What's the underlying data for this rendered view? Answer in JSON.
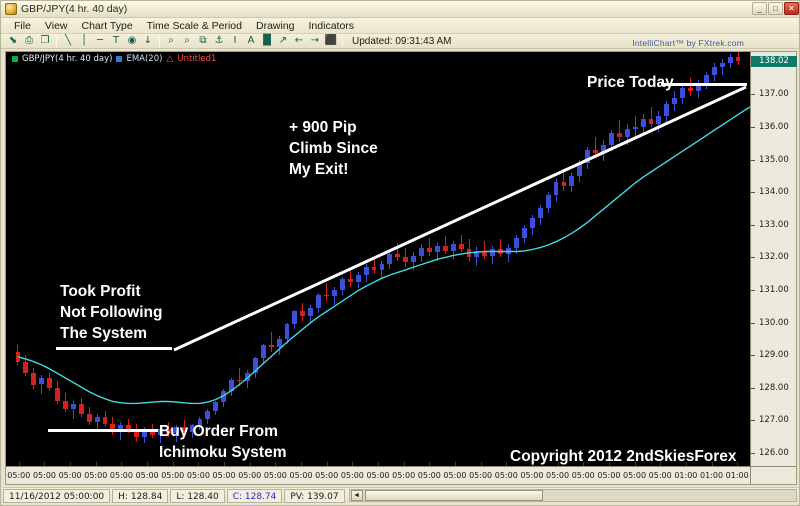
{
  "window": {
    "title": "GBP/JPY(4 hr.  40 day)",
    "app_icon": "chart-window-icon",
    "buttons": [
      {
        "name": "minimize",
        "glyph": "_"
      },
      {
        "name": "maximize",
        "glyph": "□"
      },
      {
        "name": "close",
        "glyph": "✕"
      }
    ]
  },
  "menubar": {
    "items": [
      {
        "label": "File"
      },
      {
        "label": "View"
      },
      {
        "label": "Chart Type"
      },
      {
        "label": "Time Scale & Period"
      },
      {
        "label": "Drawing"
      },
      {
        "label": "Indicators"
      }
    ]
  },
  "toolbar": {
    "updated_label": "Updated: 09:31:43 AM",
    "tools": [
      {
        "name": "cursor-select-icon",
        "glyph": "⬊"
      },
      {
        "name": "print-icon",
        "glyph": "⎙"
      },
      {
        "name": "copy-icon",
        "glyph": "❐"
      },
      {
        "name": "trendline-icon",
        "glyph": "╲"
      },
      {
        "name": "vertical-line-icon",
        "glyph": "│"
      },
      {
        "name": "horizontal-line-icon",
        "glyph": "─"
      },
      {
        "name": "text-tool-icon",
        "glyph": "T"
      },
      {
        "name": "ellipse-icon",
        "glyph": "◉"
      },
      {
        "name": "arrow-down-icon",
        "glyph": "↓"
      },
      {
        "name": "zoom-in-icon",
        "glyph": "⌕"
      },
      {
        "name": "zoom-out-icon",
        "glyph": "⌕"
      },
      {
        "name": "fib-retracement-icon",
        "glyph": "⧉"
      },
      {
        "name": "anchor-icon",
        "glyph": "⚓"
      },
      {
        "name": "i-beam-icon",
        "glyph": "I"
      },
      {
        "name": "font-icon",
        "glyph": "A"
      },
      {
        "name": "bar-chart-icon",
        "glyph": "█"
      },
      {
        "name": "line-chart-icon",
        "glyph": "↗"
      },
      {
        "name": "scroll-left-icon",
        "glyph": "←"
      },
      {
        "name": "scroll-right-icon",
        "glyph": "→"
      },
      {
        "name": "candle-icon",
        "glyph": "⬛"
      }
    ]
  },
  "chart": {
    "legend": [
      {
        "swatch_color": "#00b34a",
        "label": "GBP/JPY(4 hr.  40 day)"
      },
      {
        "swatch_color": "#2b7fd4",
        "label": "EMA(20)"
      },
      {
        "swatch_color": "#ff4a4a",
        "label": "Untitled1"
      }
    ],
    "watermark": "IntelliChart™ by FXtrek.com",
    "annotations": [
      {
        "name": "pip-climb-note",
        "lines": [
          "+ 900 Pip",
          "Climb Since",
          "My Exit!"
        ]
      },
      {
        "name": "took-profit-note",
        "lines": [
          "Took Profit",
          "Not Following",
          "The System"
        ]
      },
      {
        "name": "buy-order-note",
        "lines": [
          "Buy Order From",
          "Ichimoku System"
        ]
      },
      {
        "name": "price-today-note",
        "lines": [
          "Price Today"
        ]
      },
      {
        "name": "copyright-note",
        "lines": [
          "Copyright 2012 2ndSkiesForex"
        ]
      }
    ]
  },
  "statusbar": {
    "datetime": "11/16/2012 05:00:00",
    "high": "H: 128.84",
    "low": "L: 128.40",
    "close": "C: 128.74",
    "pv": "PV: 139.07",
    "close_color": "#2727cf",
    "scroll_left_glyph": "◄",
    "scroll_right_glyph": "►"
  },
  "chart_data": {
    "type": "line",
    "chart_subtype": "candlestick",
    "title": "GBP/JPY(4 hr.  40 day)",
    "xlabel": "",
    "ylabel": "",
    "ylim": [
      125.6,
      138.3
    ],
    "grid": false,
    "legend_position": "top-left",
    "current_price": "138.02",
    "yticks": [
      "138.02",
      "137.00",
      "136.00",
      "135.00",
      "134.00",
      "133.00",
      "132.00",
      "131.00",
      "130.00",
      "129.00",
      "128.00",
      "127.00",
      "126.00"
    ],
    "ytick_values": [
      138.02,
      137.0,
      136.0,
      135.0,
      134.0,
      133.0,
      132.0,
      131.0,
      130.0,
      129.0,
      128.0,
      127.0,
      126.0
    ],
    "xticks": [
      "05:00",
      "05:00",
      "05:00",
      "05:00",
      "05:00",
      "05:00",
      "05:00",
      "05:00",
      "05:00",
      "05:00",
      "05:00",
      "05:00",
      "05:00",
      "05:00",
      "05:00",
      "05:00",
      "05:00",
      "05:00",
      "05:00",
      "05:00",
      "05:00",
      "05:00",
      "05:00",
      "05:00",
      "05:00",
      "05:00",
      "01:00",
      "01:00",
      "01:00"
    ],
    "series": [
      {
        "name": "EMA(20)",
        "color": "#3fd8e0",
        "type": "line",
        "values": [
          128.95,
          128.88,
          128.8,
          128.7,
          128.58,
          128.44,
          128.3,
          128.16,
          128.02,
          127.88,
          127.76,
          127.66,
          127.58,
          127.54,
          127.52,
          127.52,
          127.54,
          127.56,
          127.58,
          127.58,
          127.56,
          127.54,
          127.52,
          127.52,
          127.56,
          127.64,
          127.76,
          127.92,
          128.1,
          128.3,
          128.52,
          128.74,
          128.96,
          129.18,
          129.4,
          129.6,
          129.8,
          130.0,
          130.18,
          130.34,
          130.5,
          130.66,
          130.82,
          130.98,
          131.12,
          131.24,
          131.36,
          131.46,
          131.54,
          131.62,
          131.7,
          131.78,
          131.86,
          131.94,
          132.0,
          132.06,
          132.1,
          132.14,
          132.16,
          132.18,
          132.18,
          132.18,
          132.18,
          132.18,
          132.2,
          132.24,
          132.3,
          132.38,
          132.48,
          132.6,
          132.74,
          132.9,
          133.08,
          133.28,
          133.48,
          133.68,
          133.88,
          134.08,
          134.28,
          134.46,
          134.62,
          134.78,
          134.94,
          135.1,
          135.26,
          135.42,
          135.58,
          135.74,
          135.9,
          136.06,
          136.22,
          136.38,
          136.54,
          136.68,
          136.8,
          136.9
        ]
      },
      {
        "name": "GBP/JPY candles",
        "color_up": "#3b4fd8",
        "color_down": "#d81f1f",
        "type": "candlestick",
        "ohlc": [
          [
            129.1,
            129.3,
            128.7,
            128.8
          ],
          [
            128.8,
            129.0,
            128.35,
            128.45
          ],
          [
            128.45,
            128.6,
            127.95,
            128.1
          ],
          [
            128.1,
            128.4,
            127.8,
            128.3
          ],
          [
            128.3,
            128.45,
            127.9,
            128.0
          ],
          [
            128.0,
            128.2,
            127.5,
            127.6
          ],
          [
            127.6,
            127.85,
            127.25,
            127.35
          ],
          [
            127.35,
            127.6,
            127.05,
            127.5
          ],
          [
            127.5,
            127.7,
            127.1,
            127.2
          ],
          [
            127.2,
            127.4,
            126.85,
            126.95
          ],
          [
            126.95,
            127.2,
            126.7,
            127.1
          ],
          [
            127.1,
            127.3,
            126.8,
            126.9
          ],
          [
            126.9,
            127.1,
            126.55,
            126.7
          ],
          [
            126.7,
            126.95,
            126.4,
            126.85
          ],
          [
            126.85,
            127.05,
            126.6,
            126.7
          ],
          [
            126.7,
            126.9,
            126.35,
            126.5
          ],
          [
            126.5,
            126.8,
            126.3,
            126.7
          ],
          [
            126.7,
            126.9,
            126.45,
            126.55
          ],
          [
            126.55,
            126.8,
            126.3,
            126.75
          ],
          [
            126.75,
            126.95,
            126.5,
            126.6
          ],
          [
            126.6,
            126.85,
            126.35,
            126.8
          ],
          [
            126.8,
            127.0,
            126.55,
            126.65
          ],
          [
            126.65,
            126.9,
            126.45,
            126.85
          ],
          [
            126.85,
            127.1,
            126.7,
            127.05
          ],
          [
            127.05,
            127.35,
            126.9,
            127.3
          ],
          [
            127.3,
            127.6,
            127.15,
            127.55
          ],
          [
            127.55,
            127.95,
            127.4,
            127.9
          ],
          [
            127.9,
            128.3,
            127.75,
            128.25
          ],
          [
            128.25,
            128.6,
            128.05,
            128.2
          ],
          [
            128.2,
            128.55,
            128.0,
            128.45
          ],
          [
            128.45,
            128.95,
            128.3,
            128.9
          ],
          [
            128.9,
            129.35,
            128.75,
            129.3
          ],
          [
            129.3,
            129.7,
            129.1,
            129.25
          ],
          [
            129.25,
            129.6,
            129.0,
            129.5
          ],
          [
            129.5,
            130.0,
            129.35,
            129.95
          ],
          [
            129.95,
            130.4,
            129.8,
            130.35
          ],
          [
            130.35,
            130.6,
            130.05,
            130.2
          ],
          [
            130.2,
            130.55,
            130.0,
            130.45
          ],
          [
            130.45,
            130.9,
            130.3,
            130.85
          ],
          [
            130.85,
            131.2,
            130.65,
            130.8
          ],
          [
            130.8,
            131.1,
            130.55,
            131.0
          ],
          [
            131.0,
            131.4,
            130.85,
            131.35
          ],
          [
            131.35,
            131.65,
            131.1,
            131.25
          ],
          [
            131.25,
            131.55,
            131.05,
            131.45
          ],
          [
            131.45,
            131.8,
            131.25,
            131.7
          ],
          [
            131.7,
            132.0,
            131.5,
            131.6
          ],
          [
            131.6,
            131.9,
            131.35,
            131.8
          ],
          [
            131.8,
            132.2,
            131.65,
            132.1
          ],
          [
            132.1,
            132.45,
            131.9,
            132.0
          ],
          [
            132.0,
            132.3,
            131.7,
            131.85
          ],
          [
            131.85,
            132.15,
            131.6,
            132.05
          ],
          [
            132.05,
            132.4,
            131.85,
            132.3
          ],
          [
            132.3,
            132.6,
            132.05,
            132.15
          ],
          [
            132.15,
            132.45,
            131.9,
            132.35
          ],
          [
            132.35,
            132.65,
            132.1,
            132.2
          ],
          [
            132.2,
            132.5,
            131.95,
            132.4
          ],
          [
            132.4,
            132.7,
            132.15,
            132.25
          ],
          [
            132.25,
            132.55,
            131.9,
            132.0
          ],
          [
            132.0,
            132.35,
            131.75,
            132.2
          ],
          [
            132.2,
            132.5,
            131.95,
            132.05
          ],
          [
            132.05,
            132.35,
            131.8,
            132.25
          ],
          [
            132.25,
            132.55,
            132.0,
            132.1
          ],
          [
            132.1,
            132.4,
            131.85,
            132.3
          ],
          [
            132.3,
            132.7,
            132.1,
            132.6
          ],
          [
            132.6,
            133.0,
            132.45,
            132.9
          ],
          [
            132.9,
            133.3,
            132.7,
            133.2
          ],
          [
            133.2,
            133.6,
            133.0,
            133.5
          ],
          [
            133.5,
            134.0,
            133.35,
            133.9
          ],
          [
            133.9,
            134.4,
            133.7,
            134.3
          ],
          [
            134.3,
            134.7,
            134.05,
            134.2
          ],
          [
            134.2,
            134.6,
            134.0,
            134.5
          ],
          [
            134.5,
            135.0,
            134.3,
            134.9
          ],
          [
            134.9,
            135.4,
            134.7,
            135.3
          ],
          [
            135.3,
            135.7,
            135.05,
            135.2
          ],
          [
            135.2,
            135.6,
            134.95,
            135.45
          ],
          [
            135.45,
            135.9,
            135.25,
            135.8
          ],
          [
            135.8,
            136.2,
            135.55,
            135.7
          ],
          [
            135.7,
            136.1,
            135.45,
            135.95
          ],
          [
            135.95,
            136.35,
            135.7,
            136.0
          ],
          [
            136.0,
            136.4,
            135.75,
            136.25
          ],
          [
            136.25,
            136.6,
            136.0,
            136.1
          ],
          [
            136.1,
            136.5,
            135.85,
            136.35
          ],
          [
            136.35,
            136.8,
            136.15,
            136.7
          ],
          [
            136.7,
            137.1,
            136.5,
            136.9
          ],
          [
            136.9,
            137.3,
            136.7,
            137.2
          ],
          [
            137.2,
            137.5,
            136.95,
            137.1
          ],
          [
            137.1,
            137.45,
            136.9,
            137.35
          ],
          [
            137.35,
            137.7,
            137.15,
            137.6
          ],
          [
            137.6,
            137.95,
            137.4,
            137.85
          ],
          [
            137.85,
            138.1,
            137.6,
            137.95
          ],
          [
            137.95,
            138.25,
            137.8,
            138.15
          ],
          [
            138.15,
            138.4,
            137.9,
            138.02
          ]
        ]
      }
    ],
    "drawings": [
      {
        "name": "uptrend-line",
        "type": "trendline",
        "color": "#ffffff"
      },
      {
        "name": "took-profit-hline",
        "type": "horizontal-line",
        "color": "#ffffff"
      },
      {
        "name": "buy-order-hline",
        "type": "horizontal-line",
        "color": "#ffffff"
      },
      {
        "name": "price-today-pointer",
        "type": "horizontal-line",
        "color": "#ffffff"
      }
    ]
  }
}
